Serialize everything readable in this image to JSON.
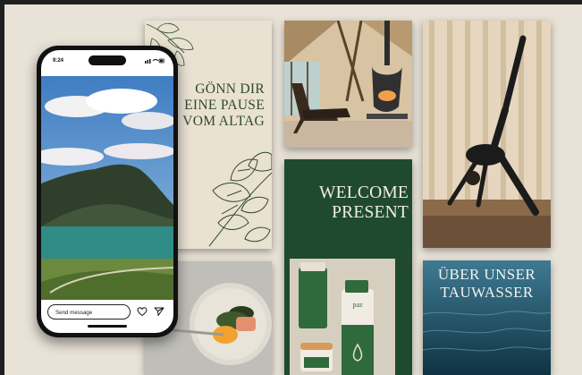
{
  "phone": {
    "status_time": "9:24",
    "message_placeholder": "Send message"
  },
  "cards": {
    "quote": {
      "lines": [
        "GÖNN DIR",
        "EINE PAUSE",
        "VOM ALTAG"
      ]
    },
    "welcome": {
      "lines": [
        "WELCOME",
        "PRESENT"
      ],
      "product_brand": "paz"
    },
    "water": {
      "lines": [
        "ÜBER UNSER",
        "TAUWASSER"
      ]
    }
  },
  "colors": {
    "board": "#e8e2d7",
    "forest_green": "#1f4a2e",
    "cream": "#e9e1d2",
    "water_blue": "#1d4f62"
  }
}
